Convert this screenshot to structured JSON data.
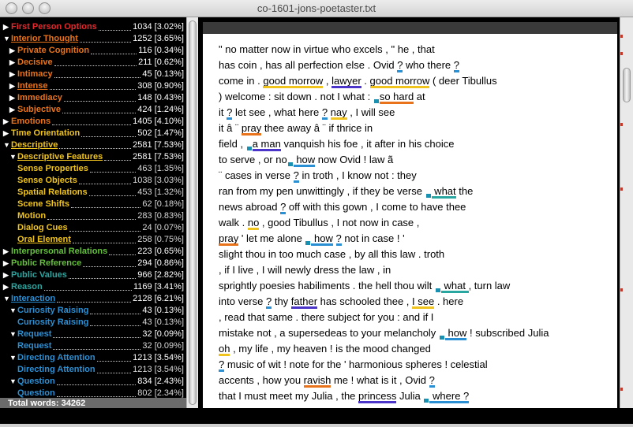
{
  "window": {
    "title": "co-1601-jons-poetaster.txt"
  },
  "colors": {
    "red": "#e8282c",
    "orange": "#e8731a",
    "yellow": "#f0c41c",
    "green": "#63c13a",
    "teal": "#2aa6a1",
    "blue": "#2b8fd4",
    "purple": "#4b34c8",
    "marker": "#1a90b0"
  },
  "tree": [
    {
      "label": "First Person Options",
      "count": "1034 [3.02%]",
      "color": "red",
      "indent": 0,
      "arrow": "right",
      "underline": false
    },
    {
      "label": "Interior Thought",
      "count": "1252 [3.65%]",
      "color": "orange",
      "indent": 0,
      "arrow": "down",
      "underline": true
    },
    {
      "label": "Private Cognition",
      "count": "116 [0.34%]",
      "color": "orange",
      "indent": 1,
      "arrow": "right",
      "underline": false
    },
    {
      "label": "Decisive",
      "count": "211 [0.62%]",
      "color": "orange",
      "indent": 1,
      "arrow": "right",
      "underline": false
    },
    {
      "label": "Intimacy",
      "count": "45 [0.13%]",
      "color": "orange",
      "indent": 1,
      "arrow": "right",
      "underline": false
    },
    {
      "label": "Intense",
      "count": "308 [0.90%]",
      "color": "orange",
      "indent": 1,
      "arrow": "right",
      "underline": true
    },
    {
      "label": "Immediacy",
      "count": "148 [0.43%]",
      "color": "orange",
      "indent": 1,
      "arrow": "right",
      "underline": false
    },
    {
      "label": "Subjective",
      "count": "424 [1.24%]",
      "color": "orange",
      "indent": 1,
      "arrow": "right",
      "underline": false
    },
    {
      "label": "Emotions",
      "count": "1405 [4.10%]",
      "color": "orange",
      "indent": 0,
      "arrow": "right",
      "underline": false
    },
    {
      "label": "Time Orientation",
      "count": "502 [1.47%]",
      "color": "yellow",
      "indent": 0,
      "arrow": "right",
      "underline": false
    },
    {
      "label": "Descriptive",
      "count": "2581 [7.53%]",
      "color": "yellow",
      "indent": 0,
      "arrow": "down",
      "underline": true
    },
    {
      "label": "Descriptive Features",
      "count": "2581 [7.53%]",
      "color": "yellow",
      "indent": 1,
      "arrow": "down",
      "underline": true
    },
    {
      "label": "Sense Properties",
      "count": "463 [1.35%]",
      "color": "yellow",
      "indent": 2,
      "arrow": "",
      "underline": false,
      "sub": true
    },
    {
      "label": "Sense Objects",
      "count": "1038 [3.03%]",
      "color": "yellow",
      "indent": 2,
      "arrow": "",
      "underline": false,
      "sub": true
    },
    {
      "label": "Spatial Relations",
      "count": "453 [1.32%]",
      "color": "yellow",
      "indent": 2,
      "arrow": "",
      "underline": false,
      "sub": true
    },
    {
      "label": "Scene Shifts",
      "count": "62 [0.18%]",
      "color": "yellow",
      "indent": 2,
      "arrow": "",
      "underline": false,
      "sub": true
    },
    {
      "label": "Motion",
      "count": "283 [0.83%]",
      "color": "yellow",
      "indent": 2,
      "arrow": "",
      "underline": false,
      "sub": true
    },
    {
      "label": "Dialog Cues",
      "count": "24 [0.07%]",
      "color": "yellow",
      "indent": 2,
      "arrow": "",
      "underline": false,
      "sub": true
    },
    {
      "label": "Oral Element",
      "count": "258 [0.75%]",
      "color": "yellow",
      "indent": 2,
      "arrow": "",
      "underline": true,
      "sub": true
    },
    {
      "label": "Interpersonal Relations",
      "count": "223 [0.65%]",
      "color": "green",
      "indent": 0,
      "arrow": "right",
      "underline": false
    },
    {
      "label": "Public Reference",
      "count": "294 [0.86%]",
      "color": "green",
      "indent": 0,
      "arrow": "right",
      "underline": false
    },
    {
      "label": "Public Values",
      "count": "966 [2.82%]",
      "color": "teal",
      "indent": 0,
      "arrow": "right",
      "underline": false
    },
    {
      "label": "Reason",
      "count": "1169 [3.41%]",
      "color": "teal",
      "indent": 0,
      "arrow": "right",
      "underline": false
    },
    {
      "label": "Interaction",
      "count": "2128 [6.21%]",
      "color": "blue",
      "indent": 0,
      "arrow": "down",
      "underline": true
    },
    {
      "label": "Curiosity Raising",
      "count": "43 [0.13%]",
      "color": "blue",
      "indent": 1,
      "arrow": "down",
      "underline": false
    },
    {
      "label": "Curiosity Raising",
      "count": "43 [0.13%]",
      "color": "blue",
      "indent": 2,
      "arrow": "",
      "underline": false,
      "sub": true
    },
    {
      "label": "Request",
      "count": "32 [0.09%]",
      "color": "blue",
      "indent": 1,
      "arrow": "down",
      "underline": false
    },
    {
      "label": "Request",
      "count": "32 [0.09%]",
      "color": "blue",
      "indent": 2,
      "arrow": "",
      "underline": false,
      "sub": true
    },
    {
      "label": "Directing Attention",
      "count": "1213 [3.54%]",
      "color": "blue",
      "indent": 1,
      "arrow": "down",
      "underline": false
    },
    {
      "label": "Directing Attention",
      "count": "1213 [3.54%]",
      "color": "blue",
      "indent": 2,
      "arrow": "",
      "underline": false,
      "sub": true
    },
    {
      "label": "Question",
      "count": "834 [2.43%]",
      "color": "blue",
      "indent": 1,
      "arrow": "down",
      "underline": false
    },
    {
      "label": "Question",
      "count": "802 [2.34%]",
      "color": "blue",
      "indent": 2,
      "arrow": "",
      "underline": false,
      "sub": true
    }
  ],
  "total_words": "Total words: 34262",
  "text_lines": [
    [
      [
        "t",
        "\" no matter now in virtue who excels , \" he , that"
      ]
    ],
    [
      [
        "t",
        "has coin , has all perfection else . Ovid "
      ],
      [
        "h",
        "?",
        "blue"
      ],
      [
        "t",
        " who there "
      ],
      [
        "h",
        "?",
        "blue"
      ]
    ],
    [
      [
        "t",
        "come in . "
      ],
      [
        "h",
        "good morrow",
        "yellow"
      ],
      [
        "t",
        " , "
      ],
      [
        "h",
        "lawyer",
        "purple"
      ],
      [
        "t",
        " . "
      ],
      [
        "h",
        "good morrow",
        "yellow"
      ],
      [
        "t",
        " ( deer Tibullus"
      ]
    ],
    [
      [
        "t",
        ") welcome : sit down . not I what : "
      ],
      [
        "m"
      ],
      [
        "h",
        "so hard",
        "orange"
      ],
      [
        "t",
        " at"
      ]
    ],
    [
      [
        "t",
        "it "
      ],
      [
        "h",
        "?",
        "blue"
      ],
      [
        "t",
        " let see , what here "
      ],
      [
        "h",
        "?",
        "blue"
      ],
      [
        "t",
        " "
      ],
      [
        "h",
        "nay",
        "yellow"
      ],
      [
        "t",
        " , I will see"
      ]
    ],
    [
      [
        "t",
        "it â  ¨ "
      ],
      [
        "h",
        "pray",
        "orange"
      ],
      [
        "t",
        " thee away â  ¨ if thrice in"
      ]
    ],
    [
      [
        "t",
        "field , "
      ],
      [
        "m"
      ],
      [
        "h",
        "a man",
        "purple"
      ],
      [
        "t",
        " vanquish his foe , it after in his choice"
      ]
    ],
    [
      [
        "t",
        "to serve , or no"
      ],
      [
        "m"
      ],
      [
        "h",
        " how",
        "blue"
      ],
      [
        "t",
        " now Ovid ! law ã"
      ]
    ],
    [
      [
        "t",
        "¨ cases in verse "
      ],
      [
        "h",
        "?",
        "blue"
      ],
      [
        "t",
        " in troth , I know not : they"
      ]
    ],
    [
      [
        "t",
        "ran from my pen unwittingly , if they be verse "
      ],
      [
        "m"
      ],
      [
        "h",
        " what",
        "teal"
      ],
      [
        "t",
        " the"
      ]
    ],
    [
      [
        "t",
        "news abroad "
      ],
      [
        "h",
        "?",
        "blue"
      ],
      [
        "t",
        " off with this gown , I come to have thee"
      ]
    ],
    [
      [
        "t",
        "walk . "
      ],
      [
        "h",
        "no",
        "yellow"
      ],
      [
        "t",
        " , good Tibullus , I not now in case ,"
      ]
    ],
    [
      [
        "h",
        "pray",
        "orange"
      ],
      [
        "t",
        " ' let me alone "
      ],
      [
        "m"
      ],
      [
        "h",
        " how",
        "blue"
      ],
      [
        "t",
        " "
      ],
      [
        "h",
        "?",
        "blue"
      ],
      [
        "t",
        " not in case ! '"
      ]
    ],
    [
      [
        "t",
        "slight thou in too much case , by all this law . troth"
      ]
    ],
    [
      [
        "t",
        ", if I live , I will newly dress the law , in"
      ]
    ],
    [
      [
        "t",
        "sprightly poesies habiliments . the hell thou wilt "
      ],
      [
        "m"
      ],
      [
        "h",
        " what ",
        "teal"
      ],
      [
        "t",
        ", turn law"
      ]
    ],
    [
      [
        "t",
        "into verse "
      ],
      [
        "h",
        "?",
        "blue"
      ],
      [
        "t",
        " thy "
      ],
      [
        "h",
        "father",
        "purple"
      ],
      [
        "t",
        " has schooled thee , "
      ],
      [
        "h",
        "I see",
        "yellow"
      ],
      [
        "t",
        " . here"
      ]
    ],
    [
      [
        "t",
        ", read that same . there subject for you : and if I"
      ]
    ],
    [
      [
        "t",
        "mistake not , a supersedeas to your melancholy "
      ],
      [
        "m"
      ],
      [
        "h",
        " how",
        "blue"
      ],
      [
        "t",
        " ! subscribed Julia"
      ]
    ],
    [
      [
        "h",
        "oh",
        "yellow"
      ],
      [
        "t",
        " , my life , my heaven ! is the mood changed"
      ]
    ],
    [
      [
        "h",
        "?",
        "blue"
      ],
      [
        "t",
        " music of wit ! note for the ' harmonious spheres ! celestial"
      ]
    ],
    [
      [
        "t",
        "accents , how you "
      ],
      [
        "h",
        "ravish",
        "orange"
      ],
      [
        "t",
        " me ! what is it , Ovid "
      ],
      [
        "h",
        "?",
        "blue"
      ]
    ],
    [
      [
        "t",
        "that I must meet my Julia , the "
      ],
      [
        "h",
        "princess",
        "purple"
      ],
      [
        "t",
        " Julia "
      ],
      [
        "m"
      ],
      [
        "h",
        " where ?",
        "blue"
      ]
    ]
  ]
}
